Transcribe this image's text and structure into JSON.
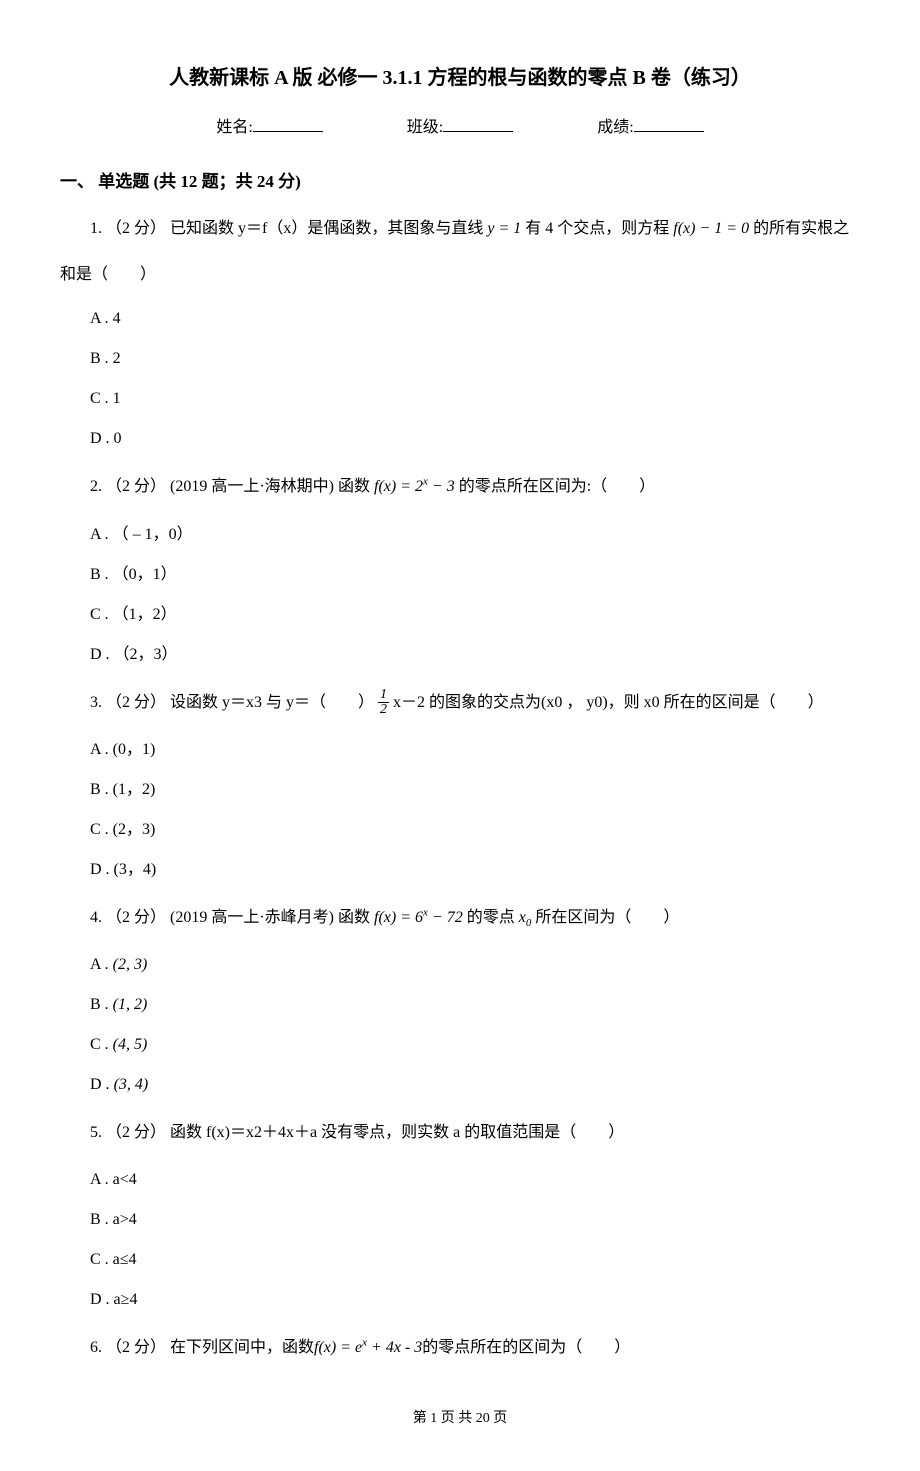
{
  "title": "人教新课标 A 版 必修一 3.1.1 方程的根与函数的零点 B 卷（练习）",
  "info": {
    "name_label": "姓名:",
    "class_label": "班级:",
    "score_label": "成绩:"
  },
  "section1": {
    "header": "一、 单选题 (共 12 题；共 24 分)"
  },
  "q1": {
    "stem_a": "1. （2 分） 已知函数 y＝f（x）是偶函数，其图象与直线 ",
    "formula1": "y = 1",
    "stem_b": " 有 4 个交点，则方程 ",
    "formula2": "f(x) − 1 = 0",
    "stem_c": " 的所有实根之",
    "stem_d": "和是（　　）",
    "A": "A . 4",
    "B": "B . 2",
    "C": "C . 1",
    "D": "D . 0"
  },
  "q2": {
    "stem_a": "2. （2 分） (2019 高一上·海林期中) 函数 ",
    "formula1": "f(x) = 2",
    "exp": "x",
    "formula2": " − 3",
    "stem_b": " 的零点所在区间为:（　　）",
    "A": "A . （ – 1，0）",
    "B": "B . （0，1）",
    "C": "C . （1，2）",
    "D": "D . （2，3）"
  },
  "q3": {
    "stem_a": "3. （2 分） 设函数 y＝x3 与 y＝（　　）",
    "frac_num": "1",
    "frac_den": "2",
    "stem_b": " x－2 的图象的交点为(x0 ， y0)，则 x0 所在的区间是（　　）",
    "A": "A . (0，1)",
    "B": "B . (1，2)",
    "C": "C . (2，3)",
    "D": "D . (3，4)"
  },
  "q4": {
    "stem_a": "4. （2 分） (2019 高一上·赤峰月考) 函数 ",
    "formula1": "f(x) = 6",
    "exp": "x",
    "formula2": " − 72",
    "stem_b": " 的零点 ",
    "x0": "x",
    "x0sub": "0",
    "stem_c": " 所在区间为（　　）",
    "A_pre": "A . ",
    "A": "(2, 3)",
    "B_pre": "B . ",
    "B": "(1, 2)",
    "C_pre": "C . ",
    "C": "(4, 5)",
    "D_pre": "D . ",
    "D": "(3, 4)"
  },
  "q5": {
    "stem": "5. （2 分） 函数 f(x)＝x2＋4x＋a 没有零点，则实数 a 的取值范围是（　　）",
    "A": "A . a<4",
    "B": "B . a>4",
    "C": "C . a≤4",
    "D": "D . a≥4"
  },
  "q6": {
    "stem_a": "6. （2 分） 在下列区间中，函数",
    "formula1": "f(x) = e",
    "exp": "x",
    "formula2": " + 4x - 3",
    "stem_b": "的零点所在的区间为（　　）"
  },
  "footer": "第 1 页 共 20 页"
}
